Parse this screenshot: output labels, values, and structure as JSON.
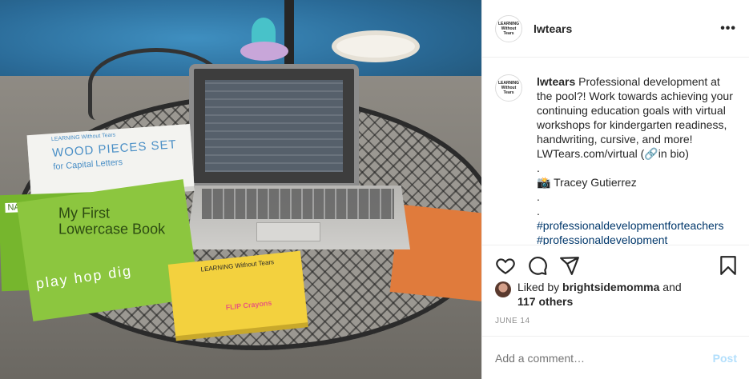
{
  "post": {
    "username": "lwtears",
    "more_icon": "more-horizontal-icon",
    "avatar_text": [
      "LEARNING",
      "Without Tears"
    ],
    "caption": {
      "username": "lwtears",
      "body": "Professional development at the pool?! Work towards achieving your continuing education goals with virtual workshops for kindergarten readiness, handwriting, cursive, and more! LWTears.com/virtual (🔗in bio)",
      "lines": [
        ".",
        "📸 Tracey Gutierrez",
        ".",
        "."
      ],
      "hashtags": [
        "#professionaldevelopmentforteachers",
        "#professionaldevelopment"
      ]
    },
    "likes": {
      "prefix": "Liked by",
      "user": "brightsidemomma",
      "suffix": "and",
      "others": "117 others"
    },
    "date": "JUNE 14",
    "comment": {
      "placeholder": "Add a comment…",
      "post_label": "Post"
    }
  },
  "photo": {
    "wood_box": {
      "brand": "LEARNING Without Tears",
      "title": "WOOD PIECES SET",
      "subtitle": "for Capital Letters"
    },
    "green_book": {
      "title": "My First Lowercase Book",
      "name_label": "NAME",
      "words": "play hop dig"
    },
    "yellow_box": {
      "brand": "LEARNING Without Tears",
      "label": "FLIP Crayons"
    }
  },
  "colors": {
    "hashtag": "#00376b",
    "post_button_disabled": "#b2dffc",
    "muted_text": "#8e8e8e",
    "divider": "#efefef"
  }
}
